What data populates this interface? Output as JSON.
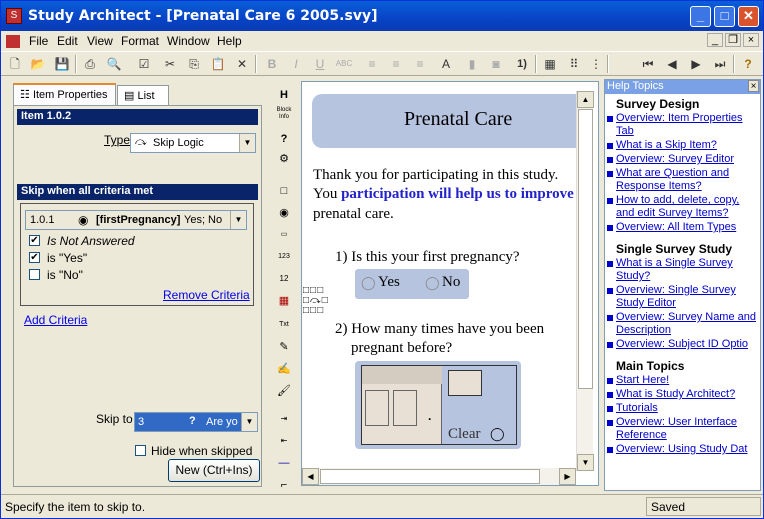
{
  "window": {
    "title": "Study Architect - [Prenatal Care 6 2005.svy]"
  },
  "menu": [
    "File",
    "Edit",
    "View",
    "Format",
    "Window",
    "Help"
  ],
  "tabs": {
    "properties": "Item Properties",
    "list": "List"
  },
  "props": {
    "item_title": "Item 1.0.2",
    "type_label": "Type",
    "type_value": "Skip Logic",
    "skip_header": "Skip when all criteria met",
    "criteria_id": "1.0.1",
    "criteria_var": "[firstPregnancy]",
    "criteria_value": "Yes; No",
    "opt1": "Is Not Answered",
    "opt2": "is \"Yes\"",
    "opt3": "is \"No\"",
    "remove": "Remove Criteria",
    "add": "Add Criteria",
    "skip_to_label": "Skip to",
    "skip_to_num": "3",
    "skip_to_text": "Are yo",
    "hide_label": "Hide when skipped",
    "new_btn": "New (Ctrl+Ins)"
  },
  "strip": {
    "h": "H",
    "block": "Block Info"
  },
  "survey": {
    "title": "Prenatal Care",
    "intro_a": "Thank you for participating in this study.",
    "intro_b": "You ",
    "intro_bold": "participation will help us to improve",
    "intro_c": "prenatal care.",
    "q1": "1) Is this your first pregnancy?",
    "yes": "Yes",
    "no": "No",
    "q2a": "2) How many times have you been",
    "q2b": "pregnant before?",
    "clear": "Clear"
  },
  "help": {
    "title": "Help Topics",
    "sec1": "Survey Design",
    "sec1_links": [
      "Overview: Item Properties Tab",
      "What is a Skip Item?",
      "Overview: Survey Editor",
      "What are Question and Response Items?",
      "How to add, delete, copy, and edit Survey Items?",
      "Overview: All Item Types"
    ],
    "sec2": "Single Survey Study",
    "sec2_links": [
      "What is a Single Survey Study?",
      "Overview: Single Survey Study Editor",
      "Overview: Survey Name and Description",
      "Overview: Subject ID Optio"
    ],
    "sec3": "Main Topics",
    "sec3_links": [
      "Start Here!",
      "What is Study Architect?",
      "Tutorials",
      "Overview: User Interface Reference",
      "Overview: Using Study Dat"
    ]
  },
  "status": {
    "text": "Specify the item to skip to.",
    "saved": "Saved"
  }
}
